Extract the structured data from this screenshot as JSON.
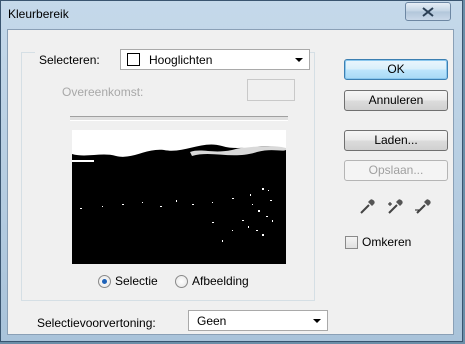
{
  "window": {
    "title": "Kleurbereik"
  },
  "select_group": {
    "label": "Selecteren:",
    "selected": "Hooglichten",
    "tolerance_label": "Overeenkomst:",
    "tolerance_value": ""
  },
  "preview_mode": {
    "options": [
      {
        "label": "Selectie",
        "selected": true
      },
      {
        "label": "Afbeelding",
        "selected": false
      }
    ]
  },
  "buttons": {
    "ok": "OK",
    "cancel": "Annuleren",
    "load": "Laden...",
    "save": "Opslaan..."
  },
  "tools": [
    "eyedropper-icon",
    "eyedropper-add-icon",
    "eyedropper-subtract-icon"
  ],
  "invert": {
    "label": "Omkeren",
    "checked": false
  },
  "selection_preview": {
    "label": "Selectievoorvertoning:",
    "selected": "Geen"
  },
  "colors": {
    "default_button": "#3c7fb1",
    "radio_dot": "#1e62b8"
  }
}
